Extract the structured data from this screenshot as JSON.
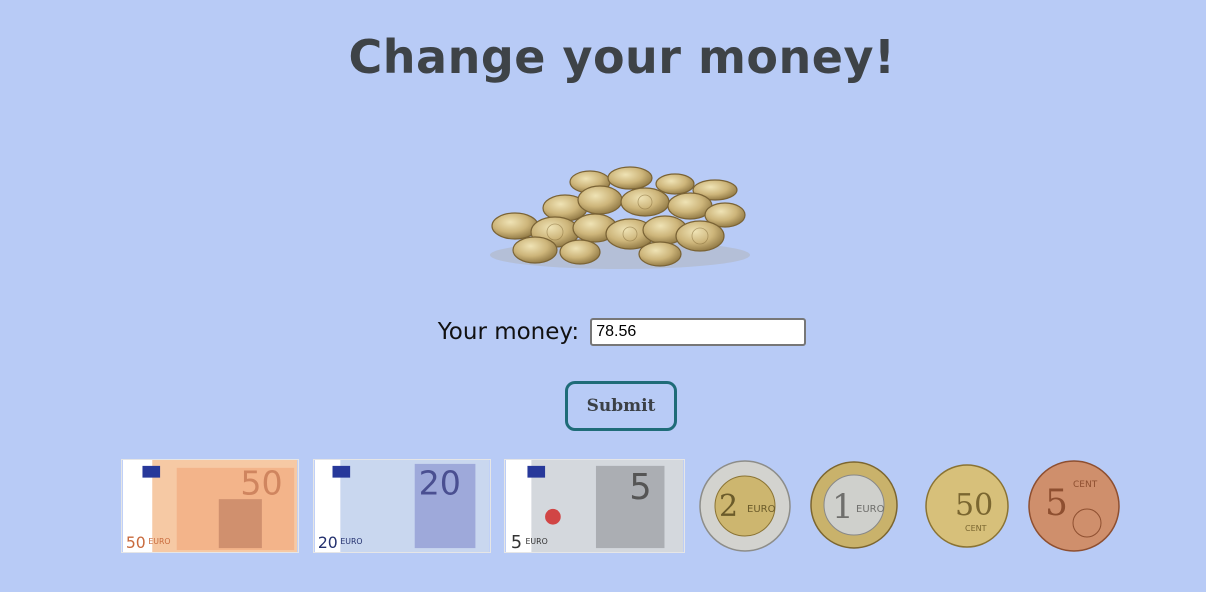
{
  "title": "Change your money!",
  "form": {
    "label": "Your money:",
    "value": "78.56",
    "submit_label": "Submit"
  },
  "denominations": {
    "notes": [
      {
        "value": "50",
        "currency": "EURO",
        "color": "#f2a46e"
      },
      {
        "value": "20",
        "currency": "EURO",
        "color": "#7d95c9"
      },
      {
        "value": "5",
        "currency": "EURO",
        "color": "#9a9a9a"
      }
    ],
    "coins": [
      {
        "value": "2",
        "unit": "EURO"
      },
      {
        "value": "1",
        "unit": "EURO"
      },
      {
        "value": "50",
        "unit": "CENT"
      },
      {
        "value": "5",
        "unit": "CENT"
      }
    ]
  },
  "colors": {
    "background": "#b8cbf6",
    "title": "#3e4347",
    "button_border": "#1f6c78"
  }
}
